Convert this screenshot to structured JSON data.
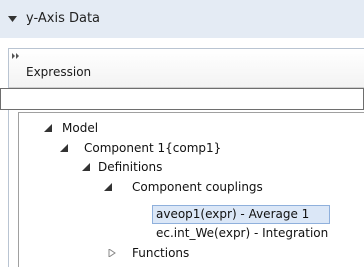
{
  "section": {
    "title": "y-Axis Data"
  },
  "table": {
    "column_header": "Expression"
  },
  "expression_input": {
    "value": "",
    "placeholder": ""
  },
  "tree": {
    "model": "Model",
    "component": "Component 1{comp1}",
    "definitions": "Definitions",
    "couplings": "Component couplings",
    "aveop": "aveop1(expr) - Average 1",
    "intop": "ec.int_We(expr) - Integration",
    "functions": "Functions"
  }
}
